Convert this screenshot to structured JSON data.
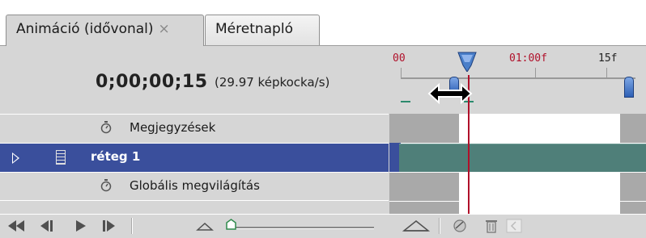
{
  "tabs": [
    {
      "label": "Animáció (idővonal)",
      "close": "×",
      "active": true
    },
    {
      "label": "Méretnapló",
      "active": false
    }
  ],
  "header": {
    "timecode": "0;00;00;15",
    "fps": "(29.97 képkocka/s)"
  },
  "ruler": {
    "labels": [
      "00",
      "01:00f",
      "15f"
    ]
  },
  "layers": [
    {
      "label": "Megjegyzések",
      "type": "comments",
      "icon": "stopwatch-icon"
    },
    {
      "label": "réteg 1",
      "type": "layer",
      "selected": true,
      "icon": "film-icon"
    },
    {
      "label": "Globális megvilágítás",
      "type": "global-light",
      "icon": "stopwatch-icon"
    }
  ],
  "toolbar": {
    "buttons": [
      "first-frame-icon",
      "prev-frame-icon",
      "play-icon",
      "next-frame-icon",
      "zoom-out-icon",
      "zoom-slider",
      "zoom-in-icon",
      "tween-icon",
      "trash-icon",
      "convert-icon"
    ]
  },
  "colors": {
    "selected_row": "#3a4f9c",
    "layer_bar": "#4f7f79",
    "playhead": "#b0102a",
    "panel_bg": "#d6d6d6",
    "timeline_bg": "#a9a9a9"
  }
}
